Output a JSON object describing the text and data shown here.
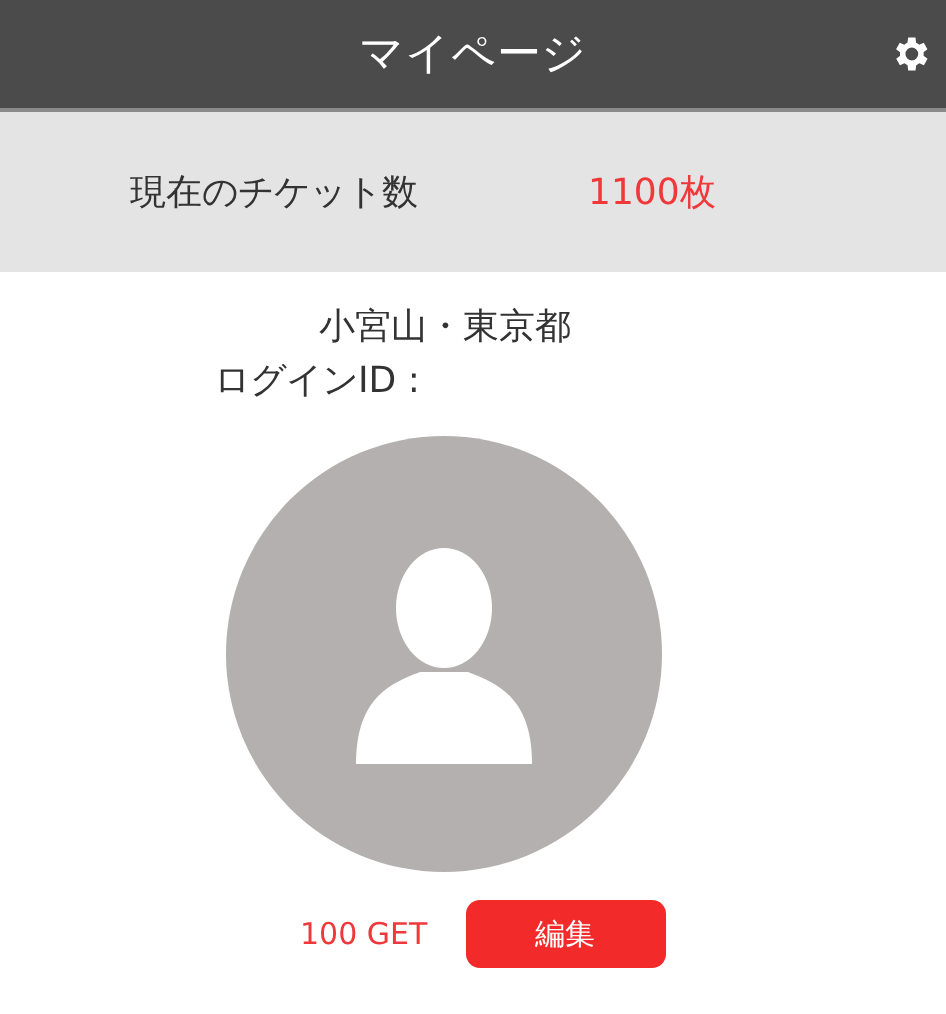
{
  "header": {
    "title": "マイページ"
  },
  "tickets": {
    "label": "現在のチケット数",
    "value": "1100枚"
  },
  "profile": {
    "name": "小宮山・東京都",
    "login_id_label": "ログインID :"
  },
  "footer": {
    "points": "100 GET",
    "edit_button": "編集"
  }
}
